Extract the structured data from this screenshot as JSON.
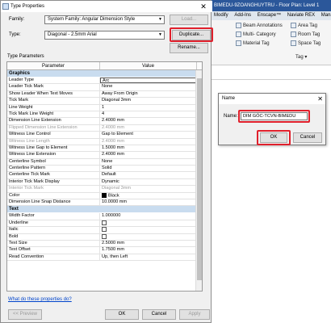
{
  "revit": {
    "title": "BIMEDU-9ZOANGHUYTRU - Floor Plan: Level 1",
    "tabs": [
      "Modify",
      "Add-Ins",
      "Enscape™",
      "Naviate REX",
      "Manage"
    ],
    "ribbon": {
      "beam_annotations": "Beam Annotations",
      "multi_category": "Multi- Category",
      "material_tag": "Material Tag",
      "area_tag": "Area Tag",
      "room_tag": "Room Tag",
      "space_tag": "Space Tag",
      "tag_panel": "Tag ▾"
    }
  },
  "type_properties": {
    "title": "Type Properties",
    "family_label": "Family:",
    "family_value": "System Family: Angular Dimension Style",
    "type_label": "Type:",
    "type_value": "Diagonal - 2.5mm Arial",
    "load_button": "Load...",
    "duplicate_button": "Duplicate...",
    "rename_button": "Rename...",
    "section_label": "Type Parameters",
    "col_parameter": "Parameter",
    "col_value": "Value",
    "groups": [
      {
        "name": "Graphics",
        "rows": [
          {
            "p": "Leader Type",
            "v": "Arc",
            "framed": true
          },
          {
            "p": "Leader Tick Mark",
            "v": "None"
          },
          {
            "p": "Show Leader When Text Moves",
            "v": "Away From Origin"
          },
          {
            "p": "Tick Mark",
            "v": "Diagonal 3mm"
          },
          {
            "p": "Line Weight",
            "v": "1"
          },
          {
            "p": "Tick Mark Line Weight",
            "v": "4"
          },
          {
            "p": "Dimension Line Extension",
            "v": "2.4000 mm"
          },
          {
            "p": "Flipped Dimension Line Extension",
            "v": "2.4000 mm",
            "dim": true
          },
          {
            "p": "Witness Line Control",
            "v": "Gap to Element"
          },
          {
            "p": "Witness Line Length",
            "v": "2.4000 mm",
            "dim": true
          },
          {
            "p": "Witness Line Gap to Element",
            "v": "1.5000 mm"
          },
          {
            "p": "Witness Line Extension",
            "v": "2.4000 mm"
          },
          {
            "p": "Centerline Symbol",
            "v": "None"
          },
          {
            "p": "Centerline Pattern",
            "v": "Solid"
          },
          {
            "p": "Centerline Tick Mark",
            "v": "Default"
          },
          {
            "p": "Interior Tick Mark Display",
            "v": "Dynamic"
          },
          {
            "p": "Interior Tick Mark",
            "v": "Diagonal 3mm",
            "dim": true
          },
          {
            "p": "Color",
            "v": "Black",
            "swatch": true
          },
          {
            "p": "Dimension Line Snap Distance",
            "v": "10.0000 mm"
          }
        ]
      },
      {
        "name": "Text",
        "rows": [
          {
            "p": "Width Factor",
            "v": "1.000000"
          },
          {
            "p": "Underline",
            "v": "",
            "check": true
          },
          {
            "p": "Italic",
            "v": "",
            "check": true
          },
          {
            "p": "Bold",
            "v": "",
            "check": true
          },
          {
            "p": "Text Size",
            "v": "2.5000 mm"
          },
          {
            "p": "Text Offset",
            "v": "1.7500 mm"
          },
          {
            "p": "Read Convention",
            "v": "Up, then Left"
          }
        ]
      }
    ],
    "help_link": "What do these properties do?",
    "preview_button": "<< Preview",
    "ok_button": "OK",
    "cancel_button": "Cancel",
    "apply_button": "Apply"
  },
  "name_dialog": {
    "title": "Name",
    "name_label": "Name:",
    "name_value": "DIM GÓC-TCVN-BIMEDU",
    "ok_button": "OK",
    "cancel_button": "Cancel"
  },
  "colors": {
    "highlight": "#e0202c",
    "group_header": "#c9dcef",
    "link": "#0044cc"
  }
}
